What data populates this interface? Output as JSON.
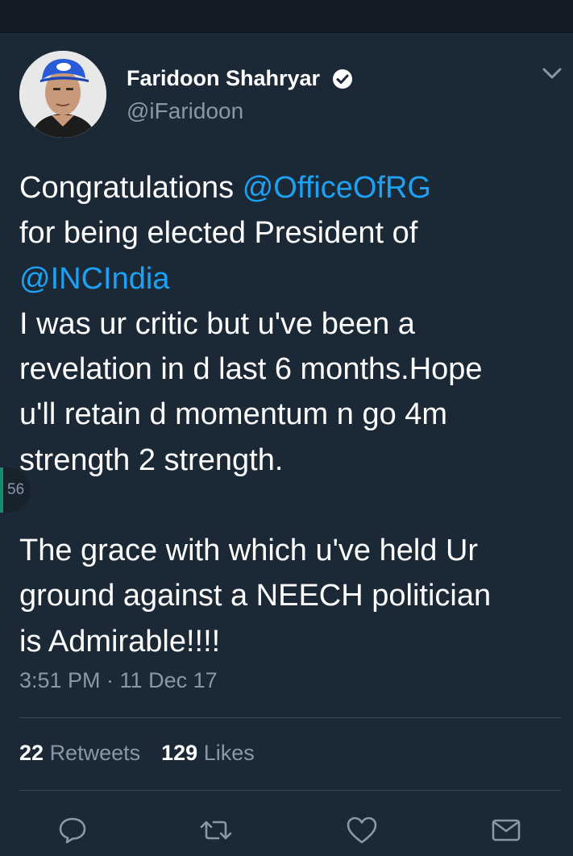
{
  "author": {
    "name": "Faridoon Shahryar",
    "handle": "@iFaridoon",
    "verified": true
  },
  "tweet": {
    "lines": [
      {
        "pre": "Congratulations ",
        "mention": "@OfficeOfRG"
      },
      {
        "text": "for being elected President of"
      },
      {
        "mention": "@INCIndia"
      },
      {
        "text": "I was ur critic but u've been a"
      },
      {
        "text": "revelation in d last 6 months.Hope"
      },
      {
        "text": "u'll retain d momentum n go 4m"
      },
      {
        "text": "strength 2 strength."
      },
      {
        "text": "The grace with which u've held Ur"
      },
      {
        "text": "ground against a NEECH politician"
      },
      {
        "text": "is Admirable!!!!"
      }
    ]
  },
  "side_badge": "56",
  "timestamp": "3:51 PM · 11 Dec 17",
  "stats": {
    "retweets_count": "22",
    "retweets_label": "Retweets",
    "likes_count": "129",
    "likes_label": "Likes"
  },
  "actions": [
    "reply-icon",
    "retweet-icon",
    "like-icon",
    "share-icon"
  ],
  "colors": {
    "background": "#1b2836",
    "accent": "#1da1f2",
    "secondary_text": "#8899a6"
  }
}
